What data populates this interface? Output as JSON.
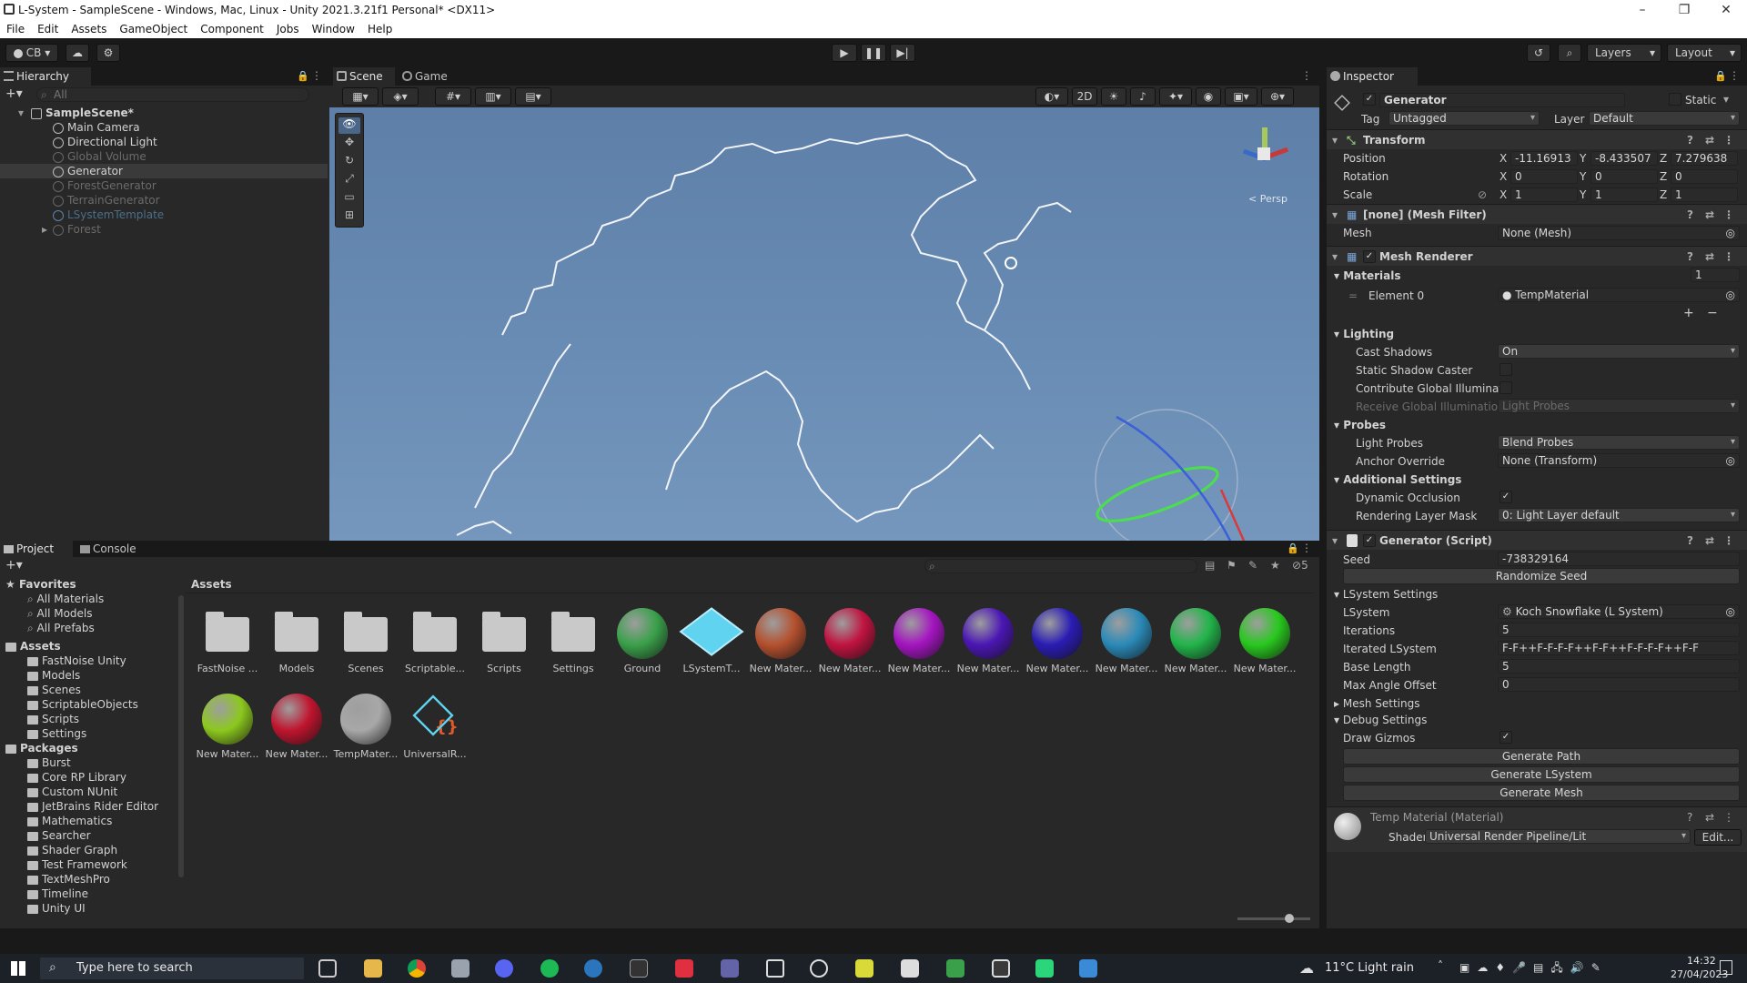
{
  "window": {
    "title": "L-System - SampleScene - Windows, Mac, Linux - Unity 2021.3.21f1 Personal* <DX11>",
    "minimize": "–",
    "maximize": "❐",
    "close": "✕"
  },
  "menu": [
    "File",
    "Edit",
    "Assets",
    "GameObject",
    "Component",
    "Jobs",
    "Window",
    "Help"
  ],
  "toolbar": {
    "account": "CB",
    "layers": "Layers",
    "layout": "Layout"
  },
  "hierarchy": {
    "tab": "Hierarchy",
    "search_placeholder": "All",
    "items": [
      {
        "label": "SampleScene*",
        "indent": 0,
        "style": "scene"
      },
      {
        "label": "Main Camera",
        "indent": 1,
        "style": "normal"
      },
      {
        "label": "Directional Light",
        "indent": 1,
        "style": "normal"
      },
      {
        "label": "Global Volume",
        "indent": 1,
        "style": "dim"
      },
      {
        "label": "Generator",
        "indent": 1,
        "style": "selected"
      },
      {
        "label": "ForestGenerator",
        "indent": 1,
        "style": "dim"
      },
      {
        "label": "TerrainGenerator",
        "indent": 1,
        "style": "dim"
      },
      {
        "label": "LSystemTemplate",
        "indent": 1,
        "style": "prefab"
      },
      {
        "label": "Forest",
        "indent": 1,
        "style": "dim"
      }
    ]
  },
  "scene": {
    "tabs": [
      "Scene",
      "Game"
    ],
    "mode_2d": "2D",
    "persp": "< Persp"
  },
  "project": {
    "tabs": [
      "Project",
      "Console"
    ],
    "breadcrumb": "Assets",
    "hidden_count": "5",
    "favorites": {
      "label": "Favorites",
      "items": [
        "All Materials",
        "All Models",
        "All Prefabs"
      ]
    },
    "assets_folder": {
      "label": "Assets",
      "items": [
        "FastNoise Unity",
        "Models",
        "Scenes",
        "ScriptableObjects",
        "Scripts",
        "Settings"
      ]
    },
    "packages": {
      "label": "Packages",
      "items": [
        "Burst",
        "Core RP Library",
        "Custom NUnit",
        "JetBrains Rider Editor",
        "Mathematics",
        "Searcher",
        "Shader Graph",
        "Test Framework",
        "TextMeshPro",
        "Timeline",
        "Unity UI"
      ]
    },
    "grid": [
      {
        "label": "FastNoise ...",
        "kind": "folder",
        "color": ""
      },
      {
        "label": "Models",
        "kind": "folder",
        "color": ""
      },
      {
        "label": "Scenes",
        "kind": "folder",
        "color": ""
      },
      {
        "label": "Scriptable...",
        "kind": "folder",
        "color": ""
      },
      {
        "label": "Scripts",
        "kind": "folder",
        "color": ""
      },
      {
        "label": "Settings",
        "kind": "folder",
        "color": ""
      },
      {
        "label": "Ground",
        "kind": "sphere",
        "color": "#3aa04a"
      },
      {
        "label": "LSystemT...",
        "kind": "cube",
        "color": "#5fd3f0"
      },
      {
        "label": "New Mater...",
        "kind": "sphere",
        "color": "#b4502e"
      },
      {
        "label": "New Mater...",
        "kind": "sphere",
        "color": "#c01340"
      },
      {
        "label": "New Mater...",
        "kind": "sphere",
        "color": "#a414c0"
      },
      {
        "label": "New Mater...",
        "kind": "sphere",
        "color": "#4a16b4"
      },
      {
        "label": "New Mater...",
        "kind": "sphere",
        "color": "#2a1cb4"
      },
      {
        "label": "New Mater...",
        "kind": "sphere",
        "color": "#2a8ab8"
      },
      {
        "label": "New Mater...",
        "kind": "sphere",
        "color": "#22b44a"
      },
      {
        "label": "New Mater...",
        "kind": "sphere",
        "color": "#28c81e"
      },
      {
        "label": "New Mater...",
        "kind": "sphere",
        "color": "#8cc81e"
      },
      {
        "label": "New Mater...",
        "kind": "sphere",
        "color": "#c0142e"
      },
      {
        "label": "TempMater...",
        "kind": "sphere",
        "color": "#a8a8a8"
      },
      {
        "label": "UniversalR...",
        "kind": "rp",
        "color": "#5fd3f0"
      }
    ]
  },
  "inspector": {
    "tab": "Inspector",
    "object_name": "Generator",
    "static_label": "Static",
    "tag_label": "Tag",
    "tag_value": "Untagged",
    "layer_label": "Layer",
    "layer_value": "Default",
    "transform": {
      "title": "Transform",
      "position_label": "Position",
      "px": "-11.16913",
      "py": "-8.433507",
      "pz": "7.279638",
      "rotation_label": "Rotation",
      "rx": "0",
      "ry": "0",
      "rz": "0",
      "scale_label": "Scale",
      "sx": "1",
      "sy": "1",
      "sz": "1",
      "x": "X",
      "y": "Y",
      "z": "Z"
    },
    "mesh_filter": {
      "title": "[none] (Mesh Filter)",
      "mesh_label": "Mesh",
      "mesh_value": "None (Mesh)"
    },
    "mesh_renderer": {
      "title": "Mesh Renderer",
      "materials_label": "Materials",
      "materials_count": "1",
      "element0_label": "Element 0",
      "element0_value": "TempMaterial",
      "lighting": "Lighting",
      "cast_shadows_label": "Cast Shadows",
      "cast_shadows_value": "On",
      "static_shadow_label": "Static Shadow Caster",
      "contribute_gi_label": "Contribute Global Illuminatic",
      "receive_gi_label": "Receive Global Illumination",
      "receive_gi_value": "Light Probes",
      "probes": "Probes",
      "light_probes_label": "Light Probes",
      "light_probes_value": "Blend Probes",
      "anchor_label": "Anchor Override",
      "anchor_value": "None (Transform)",
      "additional": "Additional Settings",
      "dyn_occ_label": "Dynamic Occlusion",
      "rlm_label": "Rendering Layer Mask",
      "rlm_value": "0: Light Layer default"
    },
    "generator": {
      "title": "Generator (Script)",
      "seed_label": "Seed",
      "seed_value": "-738329164",
      "randomize": "Randomize Seed",
      "lsys_settings": "LSystem Settings",
      "lsystem_label": "LSystem",
      "lsystem_value": "Koch Snowflake (L System)",
      "iterations_label": "Iterations",
      "iterations_value": "5",
      "iterated_label": "Iterated LSystem",
      "iterated_value": "F-F++F-F-F-F++F-F++F-F-F-F++F-F",
      "base_length_label": "Base Length",
      "base_length_value": "5",
      "max_angle_label": "Max Angle Offset",
      "max_angle_value": "0",
      "mesh_settings": "Mesh Settings",
      "debug_settings": "Debug Settings",
      "draw_gizmos_label": "Draw Gizmos",
      "gen_path": "Generate Path",
      "gen_lsystem": "Generate LSystem",
      "gen_mesh": "Generate Mesh"
    },
    "material": {
      "title": "Temp Material (Material)",
      "shader_label": "Shader",
      "shader_value": "Universal Render Pipeline/Lit",
      "edit": "Edit..."
    }
  },
  "taskbar": {
    "search_placeholder": "Type here to search",
    "weather": "11°C  Light rain",
    "time": "14:32",
    "date": "27/04/2023"
  }
}
